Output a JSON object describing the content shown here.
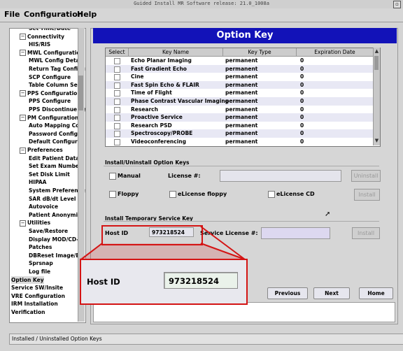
{
  "window": {
    "title": "Guided Install   MR Software release: 21.0_1008a"
  },
  "menu": {
    "file": "File",
    "configuration": "Configuration",
    "help": "Help"
  },
  "tree": {
    "items": [
      {
        "label": "Set Time/Date",
        "indent": 2
      },
      {
        "label": "Connectivity",
        "indent": 1,
        "expander": "−"
      },
      {
        "label": "HIS/RIS",
        "indent": 2
      },
      {
        "label": "MWL Configuration",
        "indent": 1,
        "expander": "−"
      },
      {
        "label": "MWL Config Detail",
        "indent": 2
      },
      {
        "label": "Return Tag Configu",
        "indent": 2
      },
      {
        "label": "SCP Configure",
        "indent": 2
      },
      {
        "label": "Table Column Sele",
        "indent": 2
      },
      {
        "label": "PPS Configuration",
        "indent": 1,
        "expander": "−"
      },
      {
        "label": "PPS Configure",
        "indent": 2
      },
      {
        "label": "PPS Discontinue Re",
        "indent": 2
      },
      {
        "label": "PM Configuration",
        "indent": 1,
        "expander": "−"
      },
      {
        "label": "Auto Mapping Con",
        "indent": 2
      },
      {
        "label": "Password Configur",
        "indent": 2
      },
      {
        "label": "Default Configurat",
        "indent": 2
      },
      {
        "label": "Preferences",
        "indent": 1,
        "expander": "−"
      },
      {
        "label": "Edit Patient Data",
        "indent": 2
      },
      {
        "label": "Set Exam Number",
        "indent": 2
      },
      {
        "label": "Set Disk Limit",
        "indent": 2
      },
      {
        "label": "HIPAA",
        "indent": 2
      },
      {
        "label": "System Preferences",
        "indent": 2
      },
      {
        "label": "SAR dB/dt Level",
        "indent": 2
      },
      {
        "label": "Autovoice",
        "indent": 2
      },
      {
        "label": "Patient Anonymiza",
        "indent": 2
      },
      {
        "label": "Utilities",
        "indent": 1,
        "expander": "−"
      },
      {
        "label": "Save/Restore",
        "indent": 2
      },
      {
        "label": "Display MOD/CD-",
        "indent": 2
      },
      {
        "label": "Patches",
        "indent": 2
      },
      {
        "label": "DBReset Image/Err",
        "indent": 2
      },
      {
        "label": "Sprsnap",
        "indent": 2
      },
      {
        "label": "Log file",
        "indent": 2
      },
      {
        "label": "Option Key",
        "indent": 0,
        "selected": true
      },
      {
        "label": "Service SW/Insite",
        "indent": 0
      },
      {
        "label": "VRE Configuration",
        "indent": 0
      },
      {
        "label": "IRM Installation",
        "indent": 0
      },
      {
        "label": "Verification",
        "indent": 0
      }
    ]
  },
  "panel": {
    "title": "Option Key"
  },
  "table": {
    "headers": [
      "Select",
      "Key Name",
      "Key Type",
      "Expiration Date"
    ],
    "rows": [
      {
        "name": "Echo Planar Imaging",
        "type": "permanent",
        "exp": "0"
      },
      {
        "name": "Fast Gradient Echo",
        "type": "permanent",
        "exp": "0"
      },
      {
        "name": "Cine",
        "type": "permanent",
        "exp": "0"
      },
      {
        "name": "Fast Spin Echo & FLAIR",
        "type": "permanent",
        "exp": "0"
      },
      {
        "name": "Time of Flight",
        "type": "permanent",
        "exp": "0"
      },
      {
        "name": "Phase Contrast Vascular Imaging",
        "type": "permanent",
        "exp": "0"
      },
      {
        "name": "Research",
        "type": "permanent",
        "exp": "0"
      },
      {
        "name": "Proactive Service",
        "type": "permanent",
        "exp": "0"
      },
      {
        "name": "Research PSD",
        "type": "permanent",
        "exp": "0"
      },
      {
        "name": "Spectroscopy/PROBE",
        "type": "permanent",
        "exp": "0"
      },
      {
        "name": "Videoconferencing",
        "type": "permanent",
        "exp": "0"
      }
    ]
  },
  "install": {
    "section": "Install/Uninstall Option Keys",
    "manual": "Manual",
    "license_label": "License #:",
    "uninstall": "Uninstall",
    "floppy": "Floppy",
    "elicense_floppy": "eLicense floppy",
    "elicense_cd": "eLicense CD",
    "install": "Install"
  },
  "temp": {
    "section": "Install Temporary Service Key",
    "host_id_label": "Host ID",
    "host_id_value": "973218524",
    "service_license_label": "Service License #:",
    "install": "Install"
  },
  "nav": {
    "previous": "Previous",
    "next": "Next",
    "home": "Home"
  },
  "callout": {
    "host_id_label": "Host ID",
    "host_id_value": "973218524"
  },
  "status": {
    "text": "Installed / Uninstalled Option Keys"
  }
}
